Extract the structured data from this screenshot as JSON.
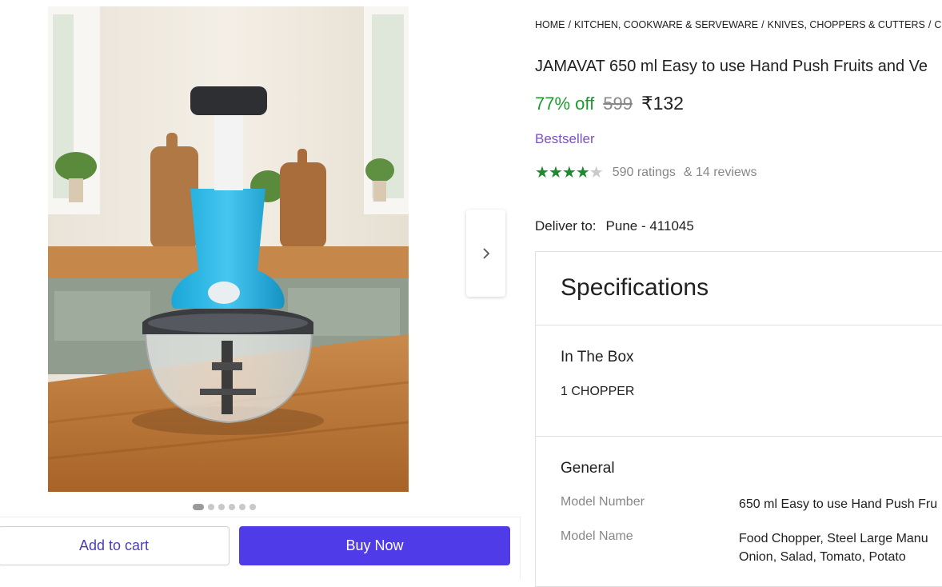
{
  "breadcrumb": [
    "HOME",
    "KITCHEN, COOKWARE & SERVEWARE",
    "KNIVES, CHOPPERS & CUTTERS",
    "CHO"
  ],
  "product": {
    "title": "JAMAVAT 650 ml Easy to use Hand Push Fruits and Ve",
    "discount": "77% off",
    "mrp": "599",
    "price": "₹132",
    "badge": "Bestseller",
    "rating_value": 4,
    "rating_max": 5,
    "ratings_text": "590 ratings",
    "reviews_text": "& 14 reviews"
  },
  "delivery": {
    "label": "Deliver to:",
    "location": "Pune - 411045"
  },
  "gallery": {
    "image_count": 6,
    "active_index": 0,
    "next_icon": "chevron-right-icon"
  },
  "actions": {
    "add_to_cart": "Add to cart",
    "buy_now": "Buy Now"
  },
  "specifications": {
    "title": "Specifications",
    "in_the_box": {
      "heading": "In The Box",
      "value": "1 CHOPPER"
    },
    "general": {
      "heading": "General",
      "rows": [
        {
          "key": "Model Number",
          "value": "650 ml Easy to use Hand Push Fru"
        },
        {
          "key": "Model Name",
          "value_line1": "Food Chopper, Steel Large Manu",
          "value_line2": "Onion, Salad, Tomato, Potato"
        }
      ]
    }
  },
  "colors": {
    "accent": "#4f3ce8",
    "discount_green": "#1e9a2e",
    "star_green": "#1e8a2e",
    "bestseller_purple": "#7c51c1"
  }
}
